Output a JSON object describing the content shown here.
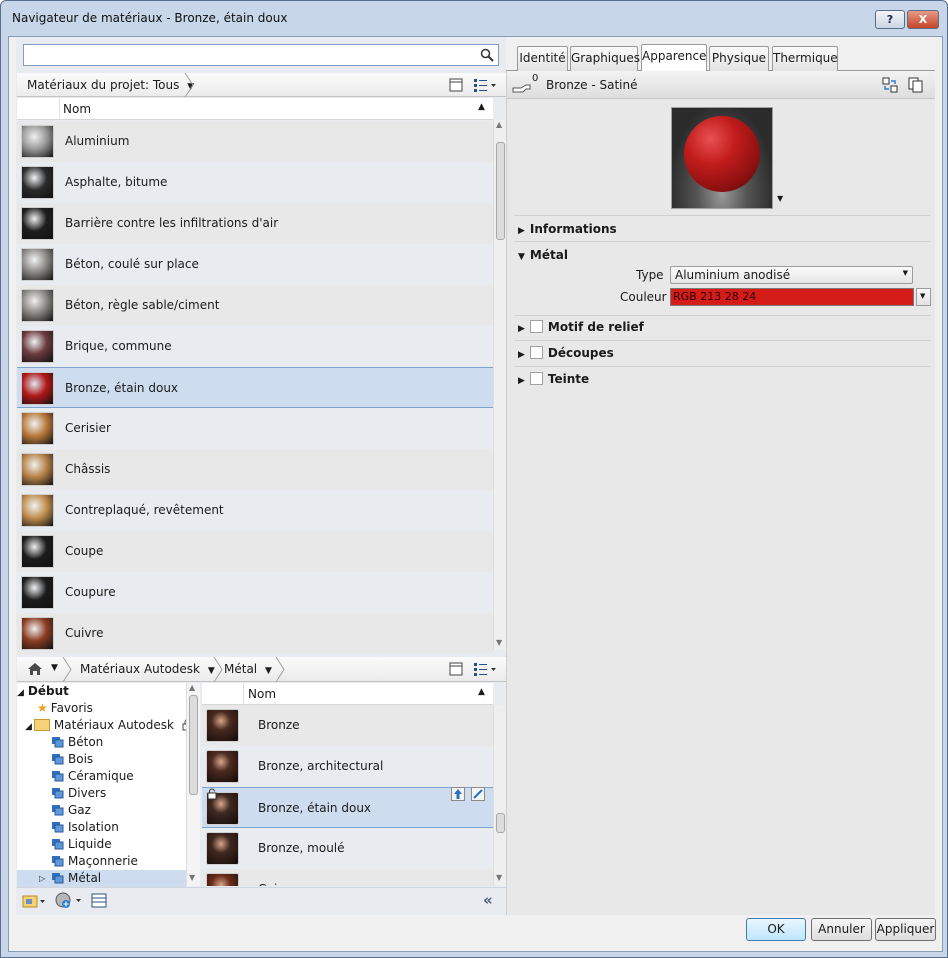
{
  "window": {
    "title": "Navigateur de matériaux - Bronze, étain doux",
    "help_label": "?",
    "close_label": "X"
  },
  "search": {
    "placeholder": "",
    "value": ""
  },
  "project_list": {
    "filter_label": "Matériaux du projet: Tous",
    "column_name": "Nom",
    "items": [
      {
        "label": "Aluminium",
        "thumb": "#9a9a9a"
      },
      {
        "label": "Asphalte, bitume",
        "thumb": "#2a2a2a"
      },
      {
        "label": "Barrière contre les infiltrations d'air",
        "thumb": "#1e1e1e"
      },
      {
        "label": "Béton, coulé sur place",
        "thumb": "#8c8a86"
      },
      {
        "label": "Béton, règle sable/ciment",
        "thumb": "#8a8884"
      },
      {
        "label": "Brique, commune",
        "thumb": "#6b3a3e"
      },
      {
        "label": "Bronze, étain doux",
        "thumb": "#b01818"
      },
      {
        "label": "Cerisier",
        "thumb": "#b97a3c"
      },
      {
        "label": "Châssis",
        "thumb": "#b58247"
      },
      {
        "label": "Contreplaqué, revêtement",
        "thumb": "#c08e4e"
      },
      {
        "label": "Coupe",
        "thumb": "#1c1c1c"
      },
      {
        "label": "Coupure",
        "thumb": "#1c1c1c"
      },
      {
        "label": "Cuivre",
        "thumb": "#8a3d22"
      }
    ],
    "selected_index": 6
  },
  "library": {
    "breadcrumb": [
      "Matériaux Autodesk",
      "Métal"
    ],
    "tree": {
      "root": "Début",
      "favorites": "Favoris",
      "library": "Matériaux Autodesk",
      "categories": [
        "Béton",
        "Bois",
        "Céramique",
        "Divers",
        "Gaz",
        "Isolation",
        "Liquide",
        "Maçonnerie",
        "Métal"
      ],
      "selected": "Métal"
    },
    "column_name": "Nom",
    "items": [
      {
        "label": "Bronze"
      },
      {
        "label": "Bronze, architectural"
      },
      {
        "label": "Bronze, étain doux"
      },
      {
        "label": "Bronze, moulé"
      },
      {
        "label": "Cuivre"
      }
    ],
    "selected_index": 2
  },
  "editor": {
    "tabs": [
      "Identité",
      "Graphiques",
      "Apparence",
      "Physique",
      "Thermique"
    ],
    "active_tab": "Apparence",
    "asset_users": "0",
    "asset_name": "Bronze - Satiné",
    "sections": {
      "informations": "Informations",
      "metal": "Métal",
      "relief": "Motif de relief",
      "decoupes": "Découpes",
      "teinte": "Teinte"
    },
    "type_label": "Type",
    "type_value": "Aluminium anodisé",
    "color_label": "Couleur",
    "color_value": "RGB 213 28 24",
    "color_hex": "#d51c18"
  },
  "footer": {
    "ok": "OK",
    "cancel": "Annuler",
    "apply": "Appliquer"
  },
  "colors": {
    "selection": "#cddcef",
    "accent_border": "#7da2ce"
  }
}
